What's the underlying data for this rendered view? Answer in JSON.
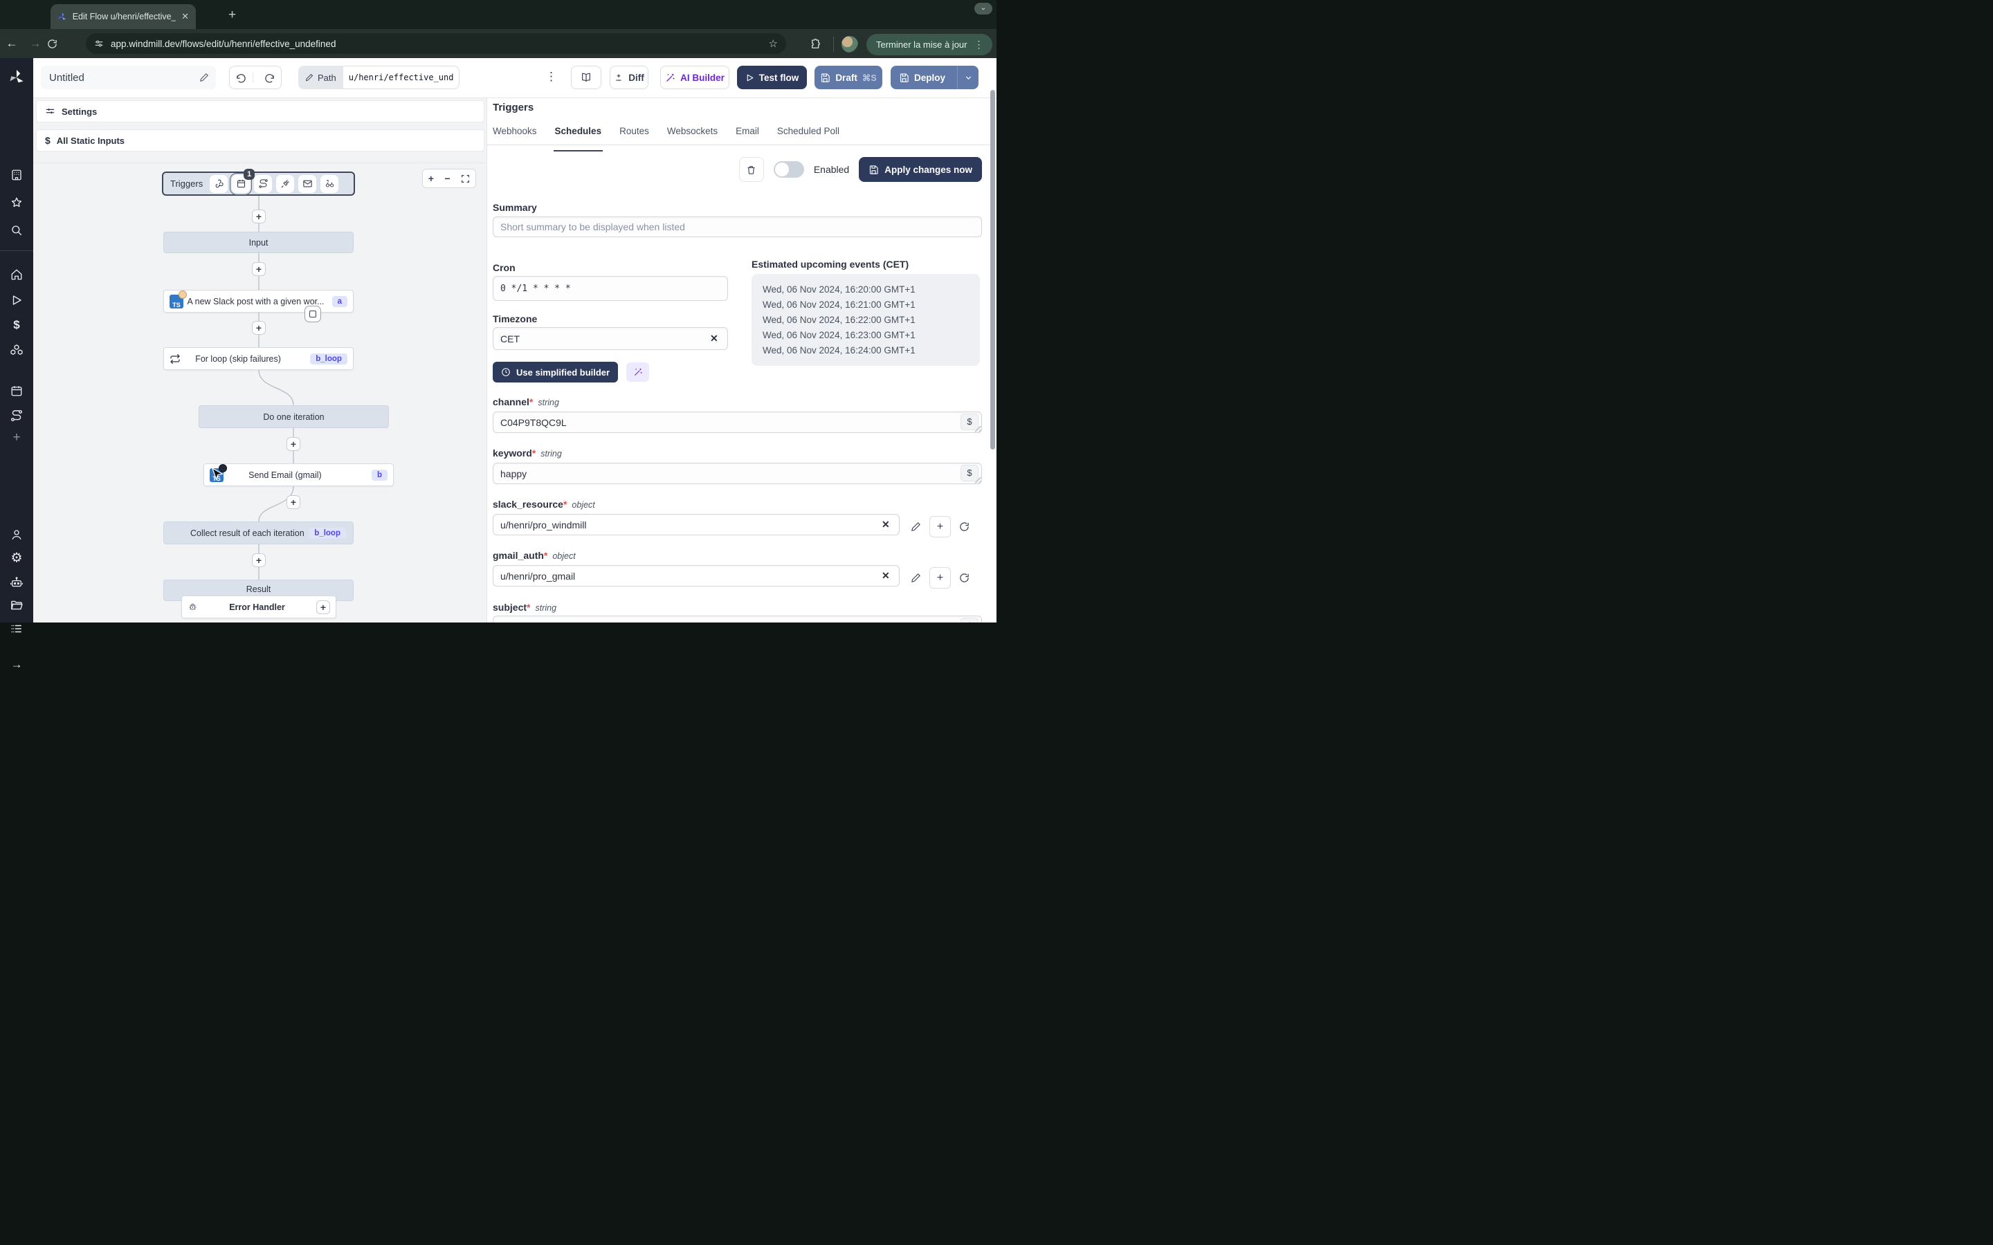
{
  "browser": {
    "tab_title": "Edit Flow u/henri/effective_un",
    "url": "app.windmill.dev/flows/edit/u/henri/effective_undefined",
    "update_button": "Terminer la mise à jour"
  },
  "header": {
    "title": "Untitled",
    "path_label": "Path",
    "path_value": "u/henri/effective_undef",
    "diff": "Diff",
    "ai_builder": "AI Builder",
    "test_flow": "Test flow",
    "draft": "Draft",
    "draft_shortcut": "⌘S",
    "deploy": "Deploy"
  },
  "left_panels": {
    "settings": "Settings",
    "static_inputs": "All Static Inputs"
  },
  "flow": {
    "triggers_label": "Triggers",
    "schedule_badge": "1",
    "input": "Input",
    "slack": {
      "label": "A new Slack post with a given wor...",
      "badge": "a"
    },
    "forloop": {
      "label": "For loop (skip failures)",
      "badge": "b_loop"
    },
    "iteration": "Do one iteration",
    "email": {
      "label": "Send Email (gmail)",
      "badge": "b"
    },
    "collect": {
      "label": "Collect result of each iteration",
      "badge": "b_loop"
    },
    "result": "Result",
    "error_handler": "Error Handler"
  },
  "triggers_panel": {
    "title": "Triggers",
    "tabs": [
      "Webhooks",
      "Schedules",
      "Routes",
      "Websockets",
      "Email",
      "Scheduled Poll"
    ],
    "active_tab": "Schedules",
    "enabled": "Enabled",
    "apply": "Apply changes now",
    "summary_label": "Summary",
    "summary_placeholder": "Short summary to be displayed when listed",
    "cron_label": "Cron",
    "cron_value": "0 */1 * * * *",
    "timezone_label": "Timezone",
    "timezone_value": "CET",
    "builder": "Use simplified builder",
    "events_title": "Estimated upcoming events (CET)",
    "events": [
      "Wed, 06 Nov 2024, 16:20:00 GMT+1",
      "Wed, 06 Nov 2024, 16:21:00 GMT+1",
      "Wed, 06 Nov 2024, 16:22:00 GMT+1",
      "Wed, 06 Nov 2024, 16:23:00 GMT+1",
      "Wed, 06 Nov 2024, 16:24:00 GMT+1"
    ]
  },
  "fields": {
    "required_mark": "*",
    "channel": {
      "name": "channel",
      "type": "string",
      "value": "C04P9T8QC9L"
    },
    "keyword": {
      "name": "keyword",
      "type": "string",
      "value": "happy"
    },
    "slack_resource": {
      "name": "slack_resource",
      "type": "object",
      "value": "u/henri/pro_windmill"
    },
    "gmail_auth": {
      "name": "gmail_auth",
      "type": "object",
      "value": "u/henri/pro_gmail"
    },
    "subject": {
      "name": "subject",
      "type": "string"
    }
  },
  "colors": {
    "navy": "#2e3a5c",
    "slate_button": "#6079a8",
    "purple": "#6d28d9",
    "badge_bg": "#e0e4fb",
    "badge_text": "#4f46e5",
    "required": "#e05252"
  }
}
